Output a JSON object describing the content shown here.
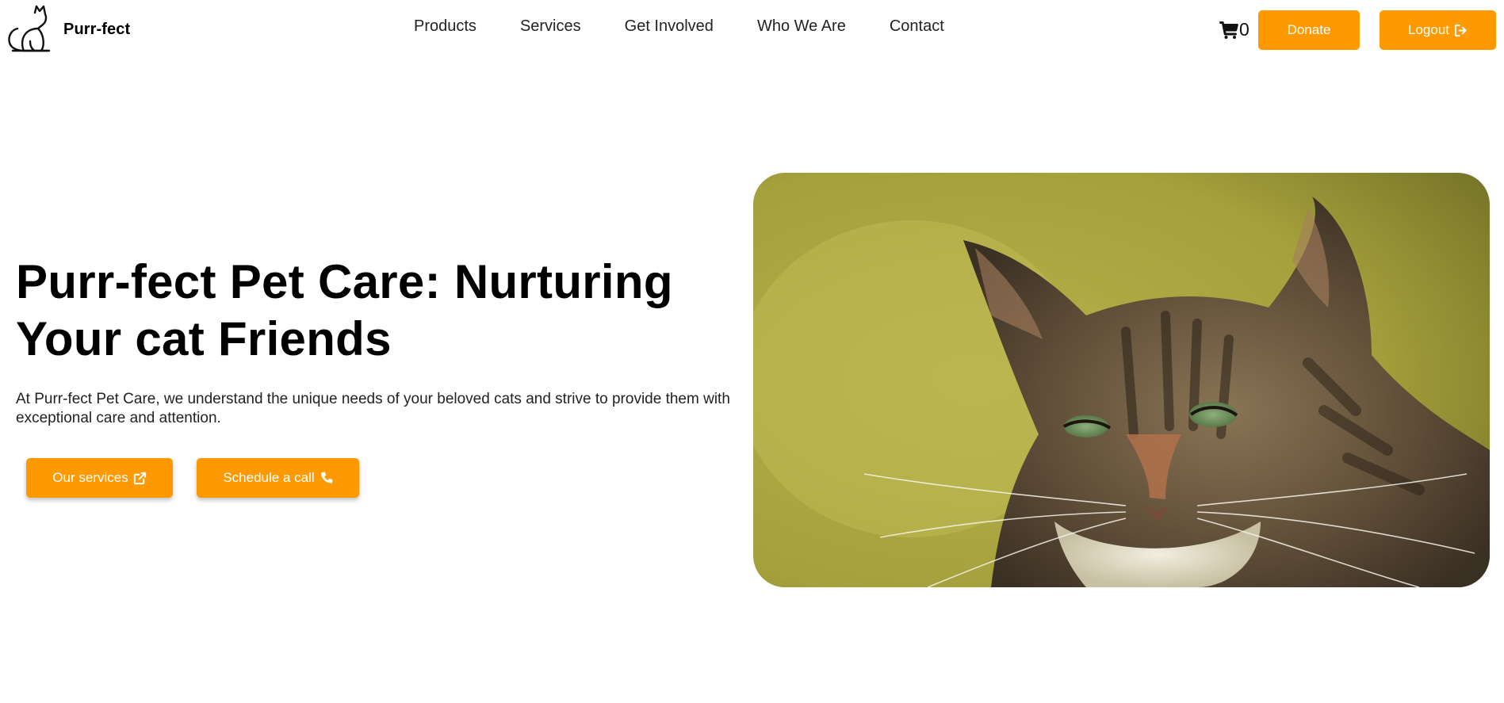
{
  "header": {
    "brand": {
      "name": "Purr-fect",
      "logo_icon": "cat-outline-icon"
    },
    "nav": [
      {
        "label": "Products"
      },
      {
        "label": "Services"
      },
      {
        "label": "Get Involved"
      },
      {
        "label": "Who We Are"
      },
      {
        "label": "Contact"
      }
    ],
    "cart": {
      "icon": "cart-icon",
      "count": "0"
    },
    "donate_label": "Donate",
    "logout_label": "Logout",
    "logout_icon": "sign-out-icon"
  },
  "hero": {
    "title": "Purr-fect Pet Care: Nurturing Your cat Friends",
    "description": "At Purr-fect Pet Care, we understand the unique needs of your beloved cats and strive to provide them with exceptional care and attention.",
    "services_button": {
      "label": "Our services",
      "icon": "external-link-icon"
    },
    "call_button": {
      "label": "Schedule a call",
      "icon": "phone-icon"
    },
    "image": {
      "subject": "tabby cat photo"
    }
  },
  "colors": {
    "accent": "#ff9900",
    "text": "#000000",
    "background": "#ffffff"
  }
}
